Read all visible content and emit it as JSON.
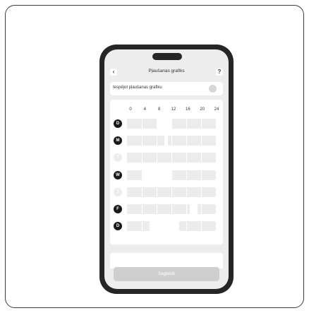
{
  "header": {
    "title": "Pļaušanas grafiks",
    "back_icon": "‹",
    "help_icon": "?"
  },
  "toggle_row": {
    "label": "Iespējot pļaušanas grafiku",
    "enabled": false
  },
  "schedule": {
    "hours": [
      "0",
      "4",
      "8",
      "12",
      "16",
      "20",
      "24"
    ],
    "days": [
      {
        "letter": "D",
        "active": true,
        "mowing": [
          [
            0,
            8
          ],
          [
            12,
            24
          ]
        ]
      },
      {
        "letter": "M",
        "active": true,
        "mowing": [
          [
            0,
            10
          ],
          [
            11,
            24
          ]
        ]
      },
      {
        "letter": "T",
        "active": false,
        "mowing": [
          [
            0,
            24
          ]
        ]
      },
      {
        "letter": "W",
        "active": true,
        "mowing": [
          [
            0,
            4
          ],
          [
            12,
            24
          ]
        ]
      },
      {
        "letter": "T",
        "active": false,
        "mowing": [
          [
            0,
            24
          ]
        ]
      },
      {
        "letter": "F",
        "active": true,
        "mowing": [
          [
            0,
            17
          ],
          [
            19,
            24
          ]
        ]
      },
      {
        "letter": "D",
        "active": true,
        "mowing": [
          [
            0,
            6
          ],
          [
            14,
            24
          ]
        ]
      }
    ]
  },
  "save_button": {
    "label": "Saglabāt"
  },
  "colors": {
    "frame": "#262626",
    "screen": "#ededed",
    "bar": "#ececec",
    "day_active": "#1a1a1a",
    "day_inactive": "#ececec",
    "button": "#cfcfcf"
  }
}
